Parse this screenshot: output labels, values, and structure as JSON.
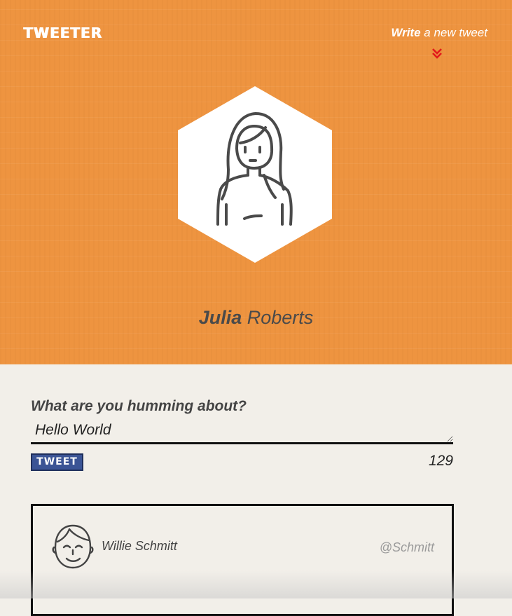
{
  "header": {
    "logo": "TWEETER",
    "write_link_strong": "Write",
    "write_link_rest": " a new tweet"
  },
  "profile": {
    "first_name": "Julia",
    "last_name": " Roberts"
  },
  "compose": {
    "label": "What are you humming about?",
    "input_value": "Hello World",
    "button_label": "TWEET",
    "char_count": "129"
  },
  "tweets": [
    {
      "name": "Willie Schmitt",
      "handle": "@Schmitt"
    }
  ],
  "colors": {
    "hero": "#ee9440",
    "button": "#3b5495",
    "chevron": "#e21b1b"
  },
  "icons": {
    "scroll_to_compose": "double-chevron-down-icon",
    "profile_avatar": "woman-avatar-icon",
    "tweet_avatar": "man-face-icon"
  }
}
